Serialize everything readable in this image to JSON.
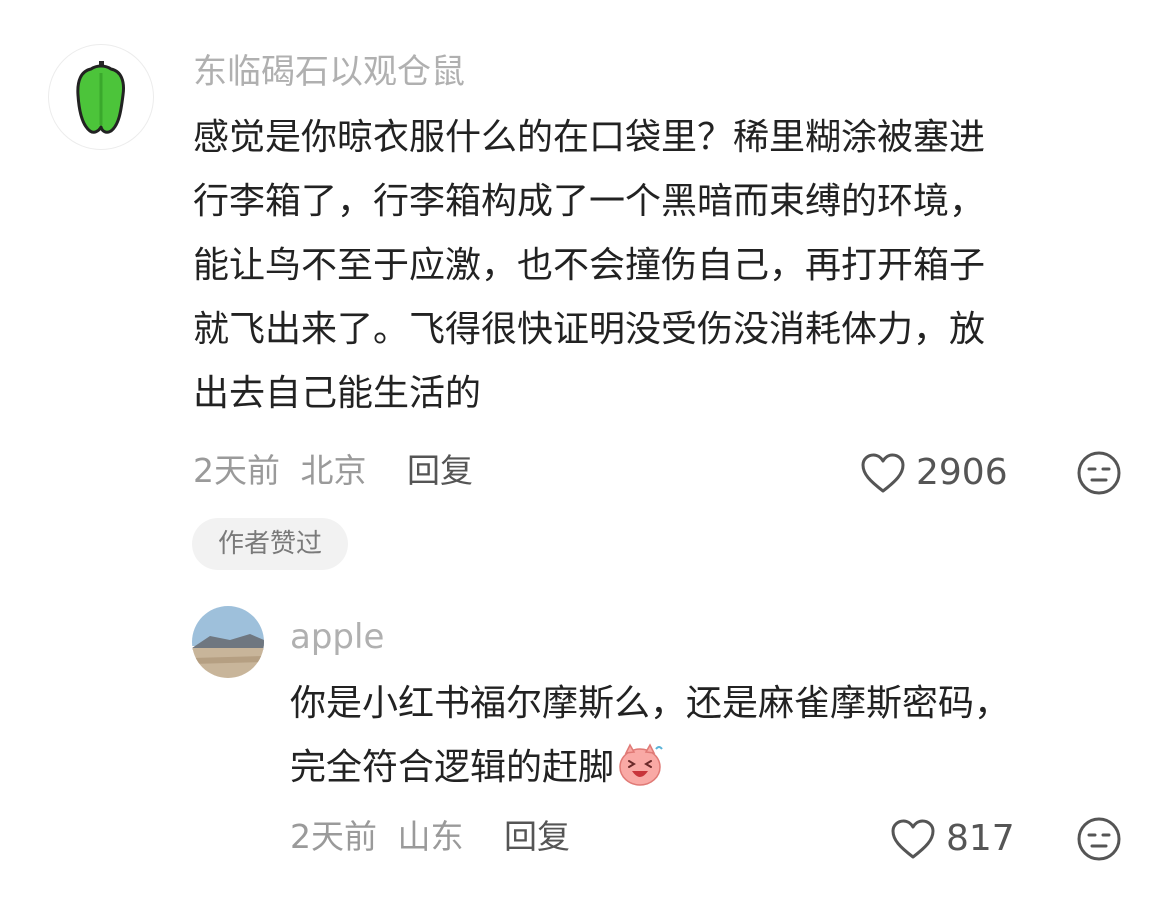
{
  "comment": {
    "username": "东临碣石以观仓鼠",
    "avatar_icon": "green-pepper-icon",
    "lines": [
      "感觉是你晾衣服什么的在口袋里？稀里糊涂被塞进",
      "行李箱了，行李箱构成了一个黑暗而束缚的环境，",
      "能让鸟不至于应激，也不会撞伤自己，再打开箱子",
      "就飞出来了。飞得很快证明没受伤没消耗体力，放",
      "出去自己能生活的"
    ],
    "time": "2天前",
    "location": "北京",
    "reply_label": "回复",
    "likes": "2906",
    "badge": "作者赞过"
  },
  "reply": {
    "username": "apple",
    "avatar_icon": "landscape-avatar",
    "lines": [
      "你是小红书福尔摩斯么，还是麻雀摩斯密码，",
      "完全符合逻辑的赶脚"
    ],
    "emoji": "laughing-pig-emoji",
    "time": "2天前",
    "location": "山东",
    "reply_label": "回复",
    "likes": "817"
  },
  "colors": {
    "username": "#b0b0b0",
    "text": "#222222",
    "meta": "#9a9a9a",
    "pepper": "#4cc43a"
  }
}
